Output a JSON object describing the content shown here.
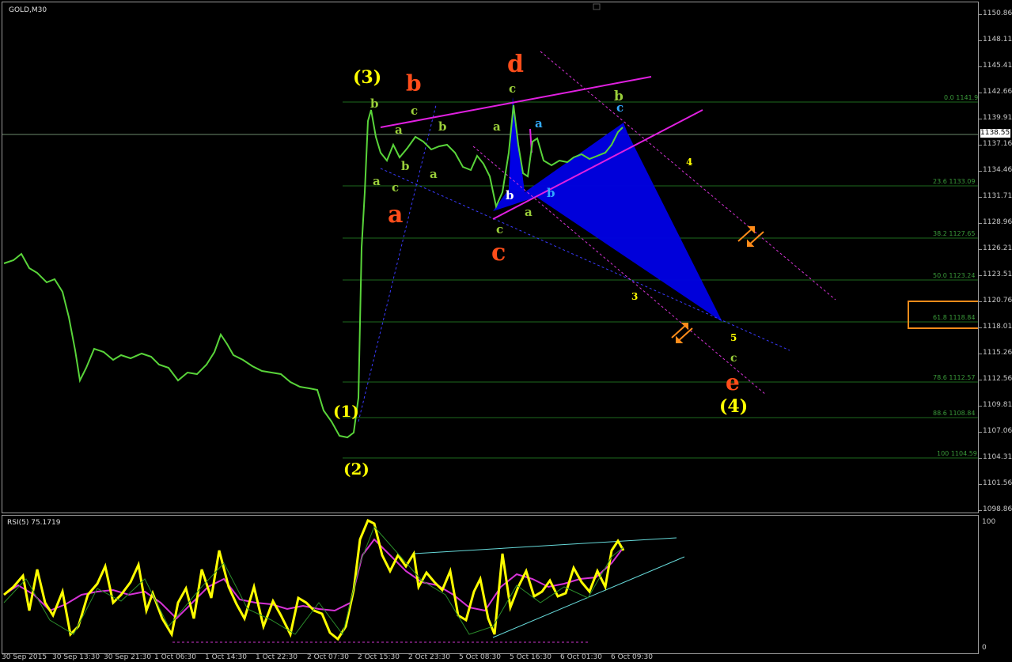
{
  "chart": {
    "title": "GOLD,M30",
    "current_price": "1138.55"
  },
  "price_axis": [
    "1150.86",
    "1148.11",
    "1145.41",
    "1142.66",
    "1139.91",
    "1137.16",
    "1134.46",
    "1131.71",
    "1128.96",
    "1126.21",
    "1123.51",
    "1120.76",
    "1118.01",
    "1115.26",
    "1112.56",
    "1109.81",
    "1107.06",
    "1104.31",
    "1101.56",
    "1098.86"
  ],
  "fib_levels": [
    "0.0 1141.90",
    "23.6 1133.09",
    "38.2 1127.65",
    "50.0 1123.24",
    "61.8 1118.84",
    "78.6 1112.57",
    "88.6 1108.84",
    "100 1104.59"
  ],
  "time_axis": [
    "30 Sep 2015",
    "30 Sep 13:30",
    "30 Sep 21:30",
    "1 Oct 06:30",
    "1 Oct 14:30",
    "1 Oct 22:30",
    "2 Oct 07:30",
    "2 Oct 15:30",
    "2 Oct 23:30",
    "5 Oct 08:30",
    "5 Oct 16:30",
    "6 Oct 01:30",
    "6 Oct 09:30"
  ],
  "rsi": {
    "title": "RSI(5) 75.1719",
    "axis_top": "100",
    "axis_bottom": "0"
  },
  "wave_labels": {
    "w3": "(3)",
    "w1": "(1)",
    "w2": "(2)",
    "w4": "(4)",
    "big_b": "b",
    "big_d": "d",
    "big_a": "a",
    "big_c": "c",
    "big_e": "e",
    "s_b1": "b",
    "s_c1": "c",
    "s_a1": "a",
    "s_b2": "b",
    "s_a2": "a",
    "s_b3": "b",
    "s_a3": "a",
    "s_c2": "c",
    "s_c3": "c",
    "s_a4": "a",
    "s_b4": "b",
    "s_c4": "c",
    "s_a5": "a",
    "s_b5": "b",
    "s_a6": "a",
    "s_c5": "c",
    "s_b6": "b",
    "n4": "4",
    "n3": "3",
    "n5": "5",
    "s_c6": "c"
  }
}
